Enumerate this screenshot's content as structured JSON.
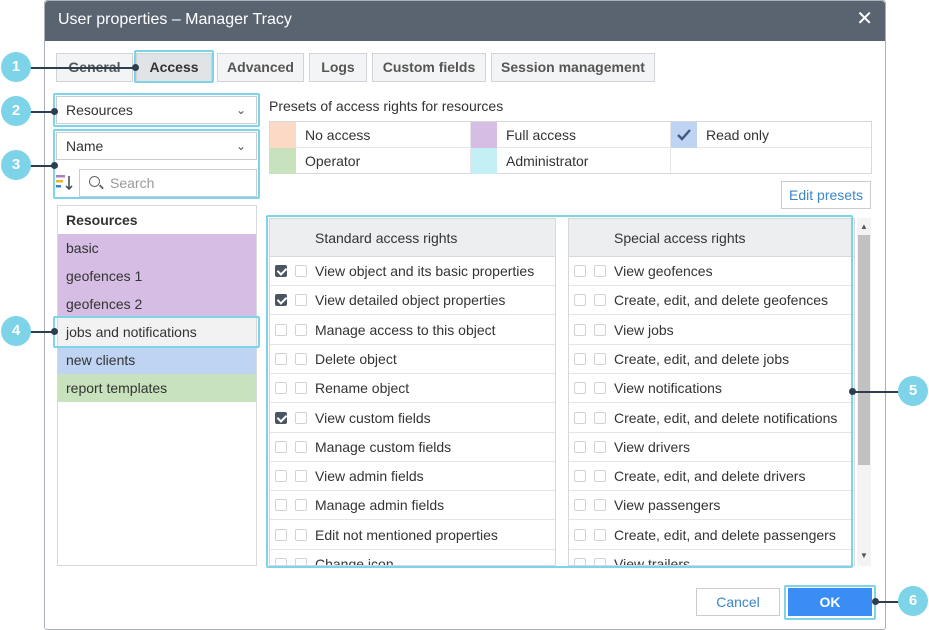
{
  "dialog": {
    "title": "User properties – Manager Tracy",
    "close_glyph": "✕"
  },
  "tabs": [
    {
      "label": "General"
    },
    {
      "label": "Access"
    },
    {
      "label": "Advanced"
    },
    {
      "label": "Logs"
    },
    {
      "label": "Custom fields"
    },
    {
      "label": "Session management"
    }
  ],
  "left": {
    "type_select": "Resources",
    "sort_select": "Name",
    "search_placeholder": "Search",
    "list_header": "Resources",
    "items": [
      {
        "label": "basic",
        "color": "#d5bde3"
      },
      {
        "label": "geofences 1",
        "color": "#d5bde3"
      },
      {
        "label": "geofences 2",
        "color": "#d5bde3"
      },
      {
        "label": "jobs and notifications",
        "color": "#f2f2f2"
      },
      {
        "label": "new clients",
        "color": "#bfd3f2"
      },
      {
        "label": "report templates",
        "color": "#c8e2bd"
      }
    ]
  },
  "presets": {
    "title": "Presets of access rights for resources",
    "items": [
      {
        "label": "No access",
        "color": "#fcd9c4"
      },
      {
        "label": "Full access",
        "color": "#d5bde3"
      },
      {
        "label": "Read only",
        "color": "#bfd3f2",
        "checked": true
      },
      {
        "label": "Operator",
        "color": "#c8e2bd"
      },
      {
        "label": "Administrator",
        "color": "#c3f0f4"
      }
    ],
    "edit_button": "Edit presets"
  },
  "standard": {
    "header": "Standard access rights",
    "rows": [
      {
        "label": "View object and its basic properties",
        "checked": true
      },
      {
        "label": "View detailed object properties",
        "checked": true
      },
      {
        "label": "Manage access to this object",
        "checked": false
      },
      {
        "label": "Delete object",
        "checked": false
      },
      {
        "label": "Rename object",
        "checked": false
      },
      {
        "label": "View custom fields",
        "checked": true
      },
      {
        "label": "Manage custom fields",
        "checked": false
      },
      {
        "label": "View admin fields",
        "checked": false
      },
      {
        "label": "Manage admin fields",
        "checked": false
      },
      {
        "label": "Edit not mentioned properties",
        "checked": false
      },
      {
        "label": "Change icon",
        "checked": false
      }
    ]
  },
  "special": {
    "header": "Special access rights",
    "rows": [
      {
        "label": "View geofences",
        "checked": false
      },
      {
        "label": "Create, edit, and delete geofences",
        "checked": false
      },
      {
        "label": "View jobs",
        "checked": false
      },
      {
        "label": "Create, edit, and delete jobs",
        "checked": false
      },
      {
        "label": "View notifications",
        "checked": false
      },
      {
        "label": "Create, edit, and delete notifications",
        "checked": false
      },
      {
        "label": "View drivers",
        "checked": false
      },
      {
        "label": "Create, edit, and delete drivers",
        "checked": false
      },
      {
        "label": "View passengers",
        "checked": false
      },
      {
        "label": "Create, edit, and delete passengers",
        "checked": false
      },
      {
        "label": "View trailers",
        "checked": false
      }
    ]
  },
  "footer": {
    "cancel": "Cancel",
    "ok": "OK"
  },
  "callouts": [
    "1",
    "2",
    "3",
    "4",
    "5",
    "6"
  ],
  "colors": {
    "accent": "#3a86c8",
    "callout": "#7dd3e8",
    "titlebar": "#5a6470",
    "ok_button": "#3a8df5"
  }
}
